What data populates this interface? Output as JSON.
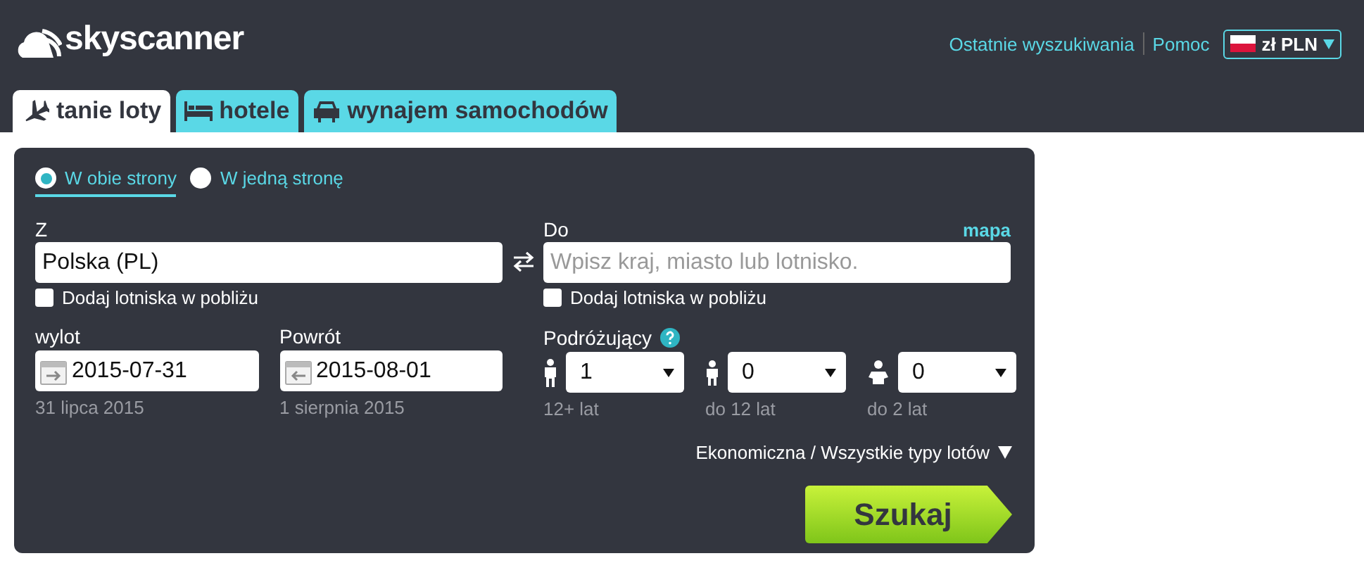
{
  "header": {
    "logo": "skyscanner",
    "links": [
      "Ostatnie wyszukiwania",
      "Pomoc"
    ],
    "currency": "zł PLN"
  },
  "tabs": [
    {
      "label": "tanie loty",
      "kind": "flights",
      "selected": true
    },
    {
      "label": "hotele",
      "kind": "hotels",
      "selected": false
    },
    {
      "label": "wynajem samochodów",
      "kind": "cars",
      "selected": false
    }
  ],
  "trip_type": [
    {
      "label": "W obie strony",
      "selected": true
    },
    {
      "label": "W jedną stronę",
      "selected": false
    }
  ],
  "from": {
    "label": "Z",
    "value": "Polska (PL)",
    "nearby_label": "Dodaj lotniska w pobliżu",
    "nearby_checked": false
  },
  "to": {
    "label": "Do",
    "placeholder": "Wpisz kraj, miasto lub lotnisko.",
    "map_link": "mapa",
    "nearby_label": "Dodaj lotniska w pobliżu",
    "nearby_checked": false
  },
  "dates": [
    {
      "label": "wylot",
      "value": "2015-07-31",
      "caption": "31 lipca 2015",
      "kind": "out"
    },
    {
      "label": "Powrót",
      "value": "2015-08-01",
      "caption": "1 sierpnia 2015",
      "kind": "back"
    }
  ],
  "travellers": {
    "label": "Podróżujący",
    "groups": [
      {
        "kind": "adult",
        "value": "1",
        "caption": "12+ lat"
      },
      {
        "kind": "child",
        "value": "0",
        "caption": "do 12 lat"
      },
      {
        "kind": "infant",
        "value": "0",
        "caption": "do 2 lat"
      }
    ]
  },
  "cabin_class": "Ekonomiczna / Wszystkie typy lotów",
  "search_button": "Szukaj"
}
